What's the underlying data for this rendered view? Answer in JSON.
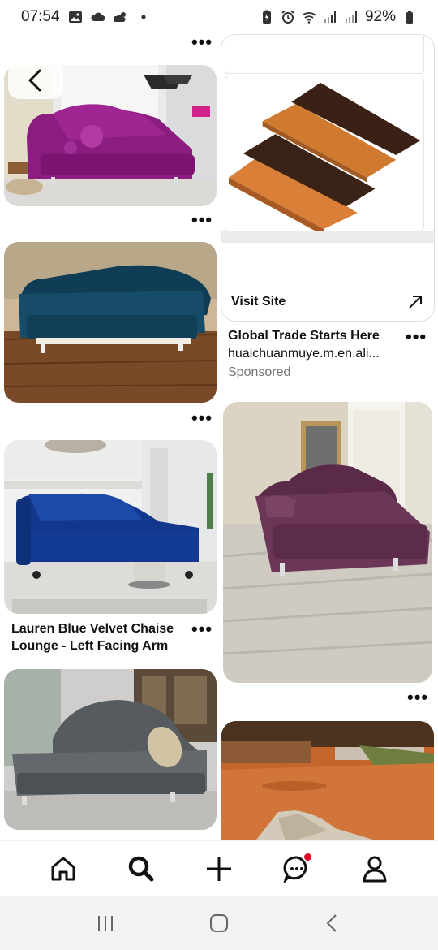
{
  "status_bar": {
    "time": "07:54",
    "battery": "92%",
    "icons_left": [
      "gallery-icon",
      "cloud-icon",
      "weather-icon",
      "dot-icon"
    ],
    "icons_right": [
      "battery-saver-icon",
      "alarm-icon",
      "wifi-icon",
      "signal-icon",
      "signal-icon",
      "battery-icon"
    ]
  },
  "feed": {
    "more_label": "•••",
    "pins_left": [
      {
        "name": "purple-chaise-pin"
      },
      {
        "name": "teal-chaise-pin"
      },
      {
        "name": "blue-chaise-pin",
        "caption": "Lauren Blue Velvet Chaise Lounge - Left Facing Arm"
      },
      {
        "name": "grey-chaise-pin"
      }
    ],
    "pins_right": [
      {
        "name": "decking-boards-pin"
      },
      {
        "name": "plum-chaise-pin"
      },
      {
        "name": "dirt-yard-pin"
      }
    ],
    "ad": {
      "visit_label": "Visit Site",
      "title": "Global Trade Starts Here",
      "domain": "huaichuanmuye.m.en.ali...",
      "sponsored": "Sponsored"
    }
  },
  "bottom_nav": {
    "items": [
      "home",
      "search",
      "create",
      "messages",
      "profile"
    ],
    "accent": "#e60023"
  },
  "system_nav": [
    "recents",
    "home",
    "back"
  ]
}
